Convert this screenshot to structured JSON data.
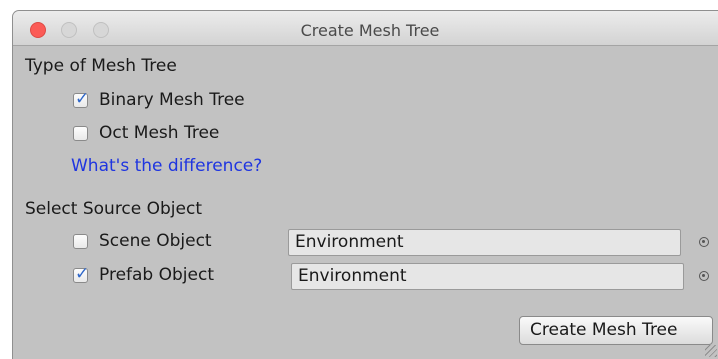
{
  "window": {
    "title": "Create Mesh Tree"
  },
  "type_section": {
    "heading": "Type of Mesh Tree",
    "options": [
      {
        "label": "Binary Mesh Tree",
        "checked": true
      },
      {
        "label": "Oct Mesh Tree",
        "checked": false
      }
    ],
    "help_link": "What's the difference?"
  },
  "source_section": {
    "heading": "Select Source Object",
    "rows": [
      {
        "label": "Scene Object",
        "checked": false,
        "value": "Environment"
      },
      {
        "label": "Prefab Object",
        "checked": true,
        "value": "Environment"
      }
    ]
  },
  "actions": {
    "create_label": "Create Mesh Tree"
  },
  "colors": {
    "window_bg": "#c2c2c2",
    "link": "#1f35e0",
    "checkmark": "#2f67c9",
    "close_button": "#fb5b56"
  },
  "icons": {
    "close": "close-icon",
    "minimize": "minimize-icon",
    "maximize": "maximize-icon",
    "checkmark": "checkmark-icon",
    "object_picker": "object-picker-icon",
    "resize": "resize-grip-icon"
  }
}
